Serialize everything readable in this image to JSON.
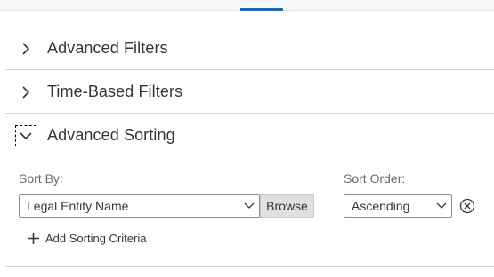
{
  "sections": [
    {
      "title": "Advanced Filters",
      "expanded": false
    },
    {
      "title": "Time-Based Filters",
      "expanded": false
    },
    {
      "title": "Advanced Sorting",
      "expanded": true
    }
  ],
  "sorting": {
    "sort_by_label": "Sort By:",
    "sort_by_value": "Legal Entity Name",
    "browse_label": "Browse",
    "sort_order_label": "Sort Order:",
    "sort_order_value": "Ascending",
    "add_label": "Add Sorting Criteria"
  },
  "icons": {
    "collapsed": "chevron-right-icon",
    "expanded": "chevron-down-icon",
    "dropdown": "chevron-down-icon",
    "remove": "close-circle-icon",
    "add": "plus-icon"
  },
  "colors": {
    "accent": "#0a6ed1",
    "icon": "#32363a",
    "divider": "#d9d9d9"
  }
}
